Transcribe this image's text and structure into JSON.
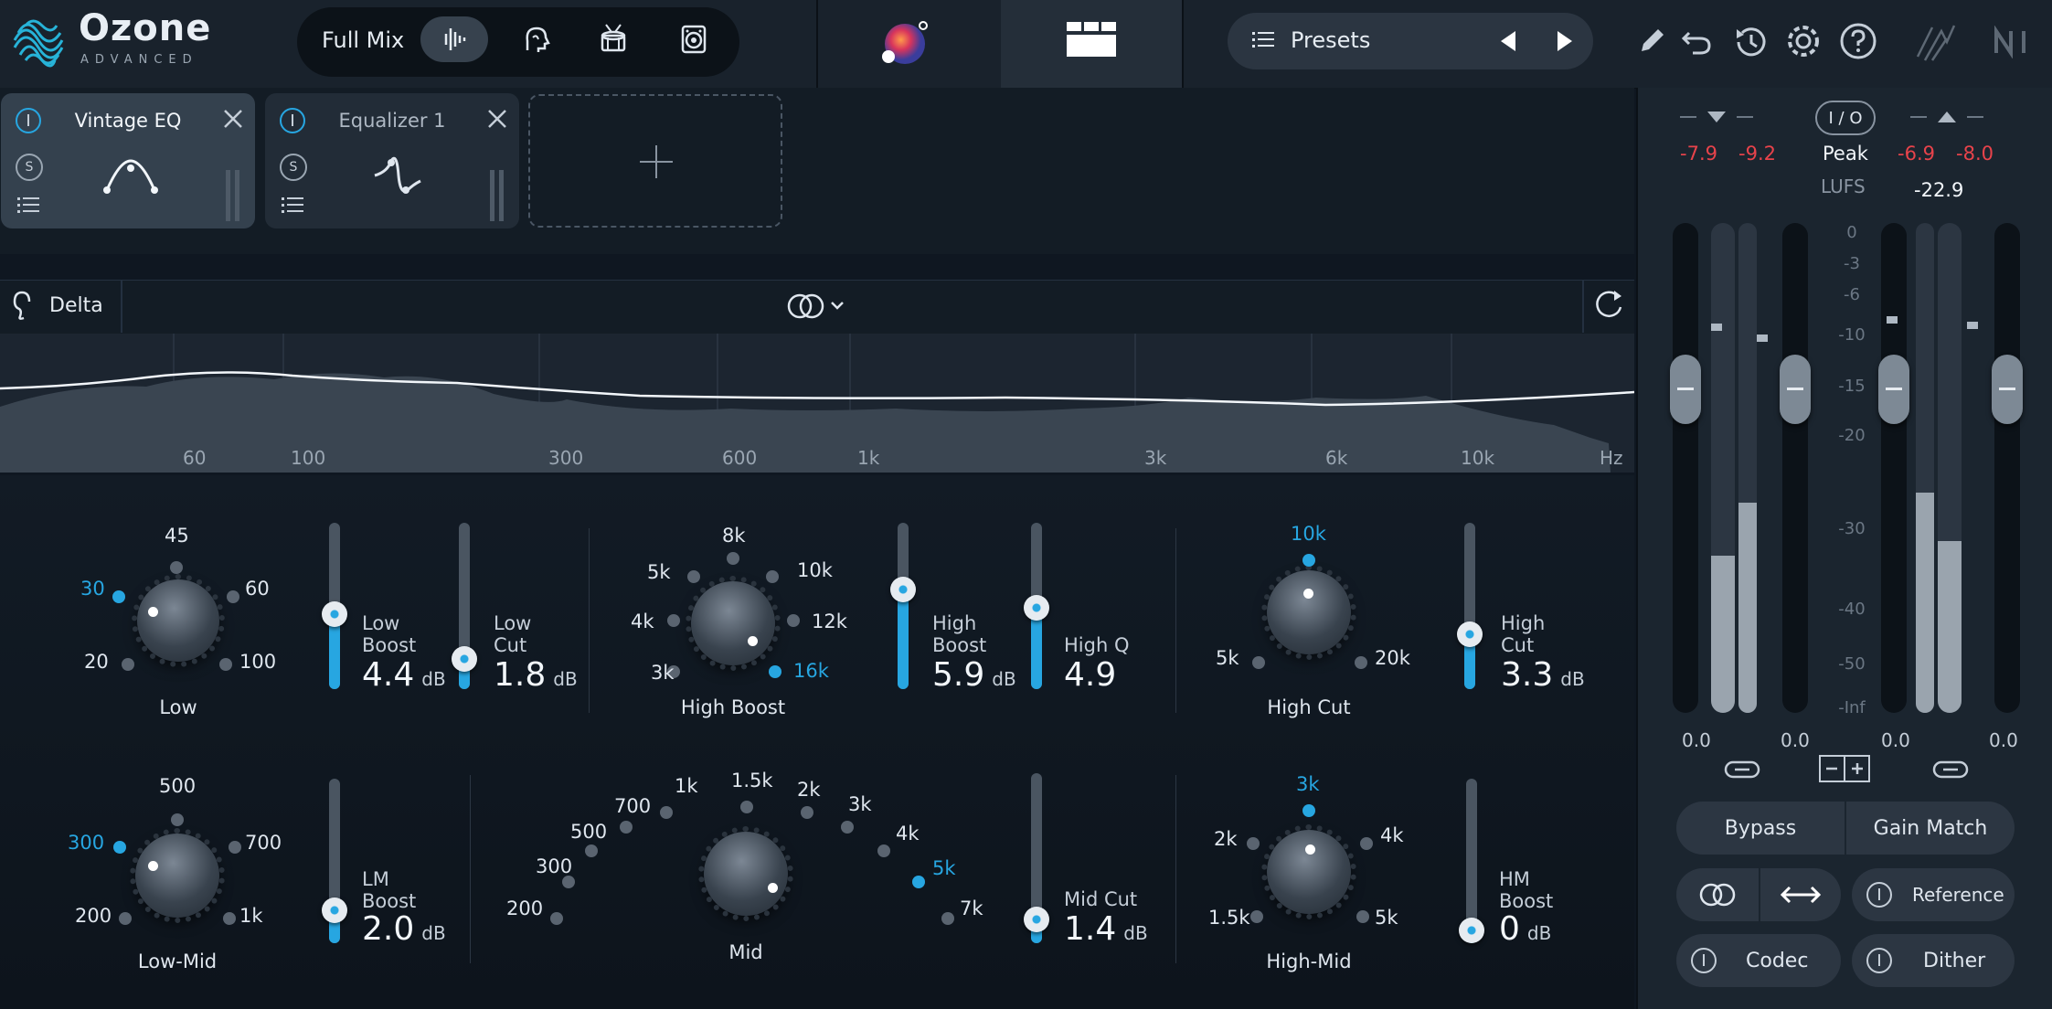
{
  "app": {
    "name": "Ozone",
    "edition": "ADVANCED"
  },
  "toolbar": {
    "mode_label": "Full Mix",
    "presets_label": "Presets"
  },
  "modules": [
    {
      "name": "Vintage EQ",
      "selected": true
    },
    {
      "name": "Equalizer 1",
      "selected": false
    }
  ],
  "spectrum": {
    "delta_label": "Delta",
    "freq_labels": [
      "60",
      "100",
      "300",
      "600",
      "1k",
      "3k",
      "6k",
      "10k",
      "Hz"
    ]
  },
  "knobs": {
    "low": {
      "name": "Low",
      "ticks": [
        "20",
        "30",
        "45",
        "60",
        "100"
      ],
      "selected": "30"
    },
    "high_boost": {
      "name": "High Boost",
      "ticks": [
        "3k",
        "4k",
        "5k",
        "8k",
        "10k",
        "12k",
        "16k"
      ],
      "selected": "16k"
    },
    "high_cut": {
      "name": "High Cut",
      "ticks": [
        "5k",
        "10k",
        "20k"
      ],
      "selected": "10k"
    },
    "low_mid": {
      "name": "Low-Mid",
      "ticks": [
        "200",
        "300",
        "500",
        "700",
        "1k"
      ],
      "selected": "300"
    },
    "mid": {
      "name": "Mid",
      "ticks": [
        "200",
        "300",
        "500",
        "700",
        "1k",
        "1.5k",
        "2k",
        "3k",
        "4k",
        "5k",
        "7k"
      ],
      "selected": "5k"
    },
    "high_mid": {
      "name": "High-Mid",
      "ticks": [
        "1.5k",
        "2k",
        "3k",
        "4k",
        "5k"
      ],
      "selected": "3k"
    }
  },
  "sliders": {
    "low_boost": {
      "name1": "Low",
      "name2": "Boost",
      "value": "4.4",
      "unit": "dB",
      "level": 0.45
    },
    "low_cut": {
      "name1": "Low",
      "name2": "Cut",
      "value": "1.8",
      "unit": "dB",
      "level": 0.18
    },
    "high_boost": {
      "name1": "High",
      "name2": "Boost",
      "value": "5.9",
      "unit": "dB",
      "level": 0.6
    },
    "high_q": {
      "name1": "",
      "name2": "High Q",
      "value": "4.9",
      "unit": "",
      "level": 0.49
    },
    "high_cut": {
      "name1": "High",
      "name2": "Cut",
      "value": "3.3",
      "unit": "dB",
      "level": 0.33
    },
    "lm_boost": {
      "name1": "LM",
      "name2": "Boost",
      "value": "2.0",
      "unit": "dB",
      "level": 0.2
    },
    "mid_cut": {
      "name1": "",
      "name2": "Mid Cut",
      "value": "1.4",
      "unit": "dB",
      "level": 0.14
    },
    "hm_boost": {
      "name1": "HM",
      "name2": "Boost",
      "value": "0",
      "unit": "dB",
      "level": 0.0
    }
  },
  "meters": {
    "io_label": "I / O",
    "in_peak_l": "-7.9",
    "in_peak_r": "-9.2",
    "out_peak_l": "-6.9",
    "out_peak_r": "-8.0",
    "peak_label": "Peak",
    "lufs_label": "LUFS",
    "lufs_value": "-22.9",
    "scale": [
      "0",
      "-3",
      "-6",
      "-10",
      "-15",
      "-20",
      "-30",
      "-40",
      "-50",
      "-Inf"
    ],
    "gains": [
      "0.0",
      "0.0",
      "0.0",
      "0.0"
    ],
    "levels": [
      0.32,
      0.43,
      0.45,
      0.35
    ]
  },
  "buttons": {
    "bypass": "Bypass",
    "gain_match": "Gain Match",
    "reference": "Reference",
    "codec": "Codec",
    "dither": "Dither"
  },
  "colors": {
    "accent": "#27a6e1",
    "peak_red": "#e8434b"
  }
}
